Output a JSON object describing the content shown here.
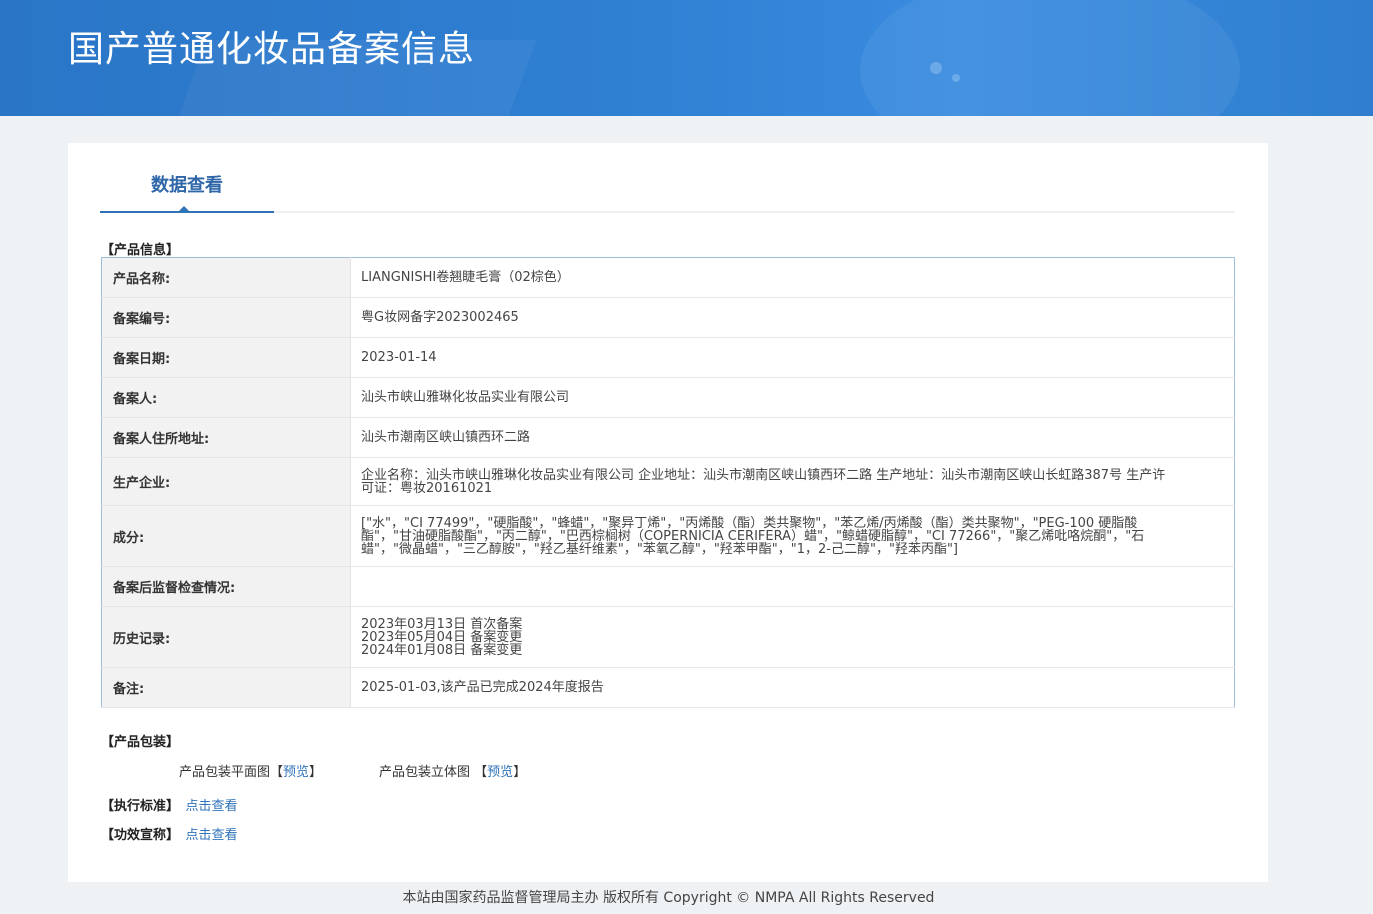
{
  "header": {
    "title": "国产普通化妆品备案信息"
  },
  "tabs": [
    {
      "label": "数据查看"
    }
  ],
  "product_info": {
    "section_title": "【产品信息】",
    "rows": [
      {
        "key": "产品名称:",
        "value": "LIANGNISHI卷翘睫毛膏（02棕色）"
      },
      {
        "key": "备案编号:",
        "value": "粤G妆网备字2023002465"
      },
      {
        "key": "备案日期:",
        "value": "2023-01-14"
      },
      {
        "key": "备案人:",
        "value": "汕头市峡山雅琳化妆品实业有限公司"
      },
      {
        "key": "备案人住所地址:",
        "value": "汕头市潮南区峡山镇西环二路"
      },
      {
        "key": "生产企业:",
        "value": "企业名称：汕头市峡山雅琳化妆品实业有限公司 企业地址：汕头市潮南区峡山镇西环二路 生产地址：汕头市潮南区峡山长虹路387号 生产许可证：粤妆20161021"
      },
      {
        "key": "成分:",
        "value": "[\"水\"，\"CI 77499\"，\"硬脂酸\"，\"蜂蜡\"，\"聚异丁烯\"，\"丙烯酸（酯）类共聚物\"，\"苯乙烯/丙烯酸（酯）类共聚物\"，\"PEG-100 硬脂酸酯\"，\"甘油硬脂酸酯\"，\"丙二醇\"，\"巴西棕榈树（COPERNICIA CERIFERA）蜡\"，\"鲸蜡硬脂醇\"，\"CI 77266\"，\"聚乙烯吡咯烷酮\"，\"石蜡\"，\"微晶蜡\"，\"三乙醇胺\"，\"羟乙基纤维素\"，\"苯氧乙醇\"，\"羟苯甲酯\"，\"1，2-己二醇\"，\"羟苯丙酯\"]"
      },
      {
        "key": "备案后监督检查情况:",
        "value": ""
      },
      {
        "key": "历史记录:",
        "lines": [
          "2023年03月13日 首次备案",
          "2023年05月04日 备案变更",
          "2024年01月08日 备案变更"
        ]
      },
      {
        "key": "备注:",
        "value": "2025-01-03,该产品已完成2024年度报告"
      }
    ]
  },
  "packaging": {
    "section_title": "【产品包装】",
    "flat_label": "产品包装平面图",
    "flat_link": "预览",
    "solid_label": "产品包装立体图",
    "solid_link": "预览",
    "bracket_open": "【",
    "bracket_close": "】"
  },
  "standard": {
    "label": "【执行标准】",
    "link": "点击查看"
  },
  "efficacy": {
    "label": "【功效宣称】",
    "link": "点击查看"
  },
  "footer": {
    "text": "本站由国家药品监督管理局主办 版权所有 Copyright © NMPA All Rights Reserved"
  }
}
